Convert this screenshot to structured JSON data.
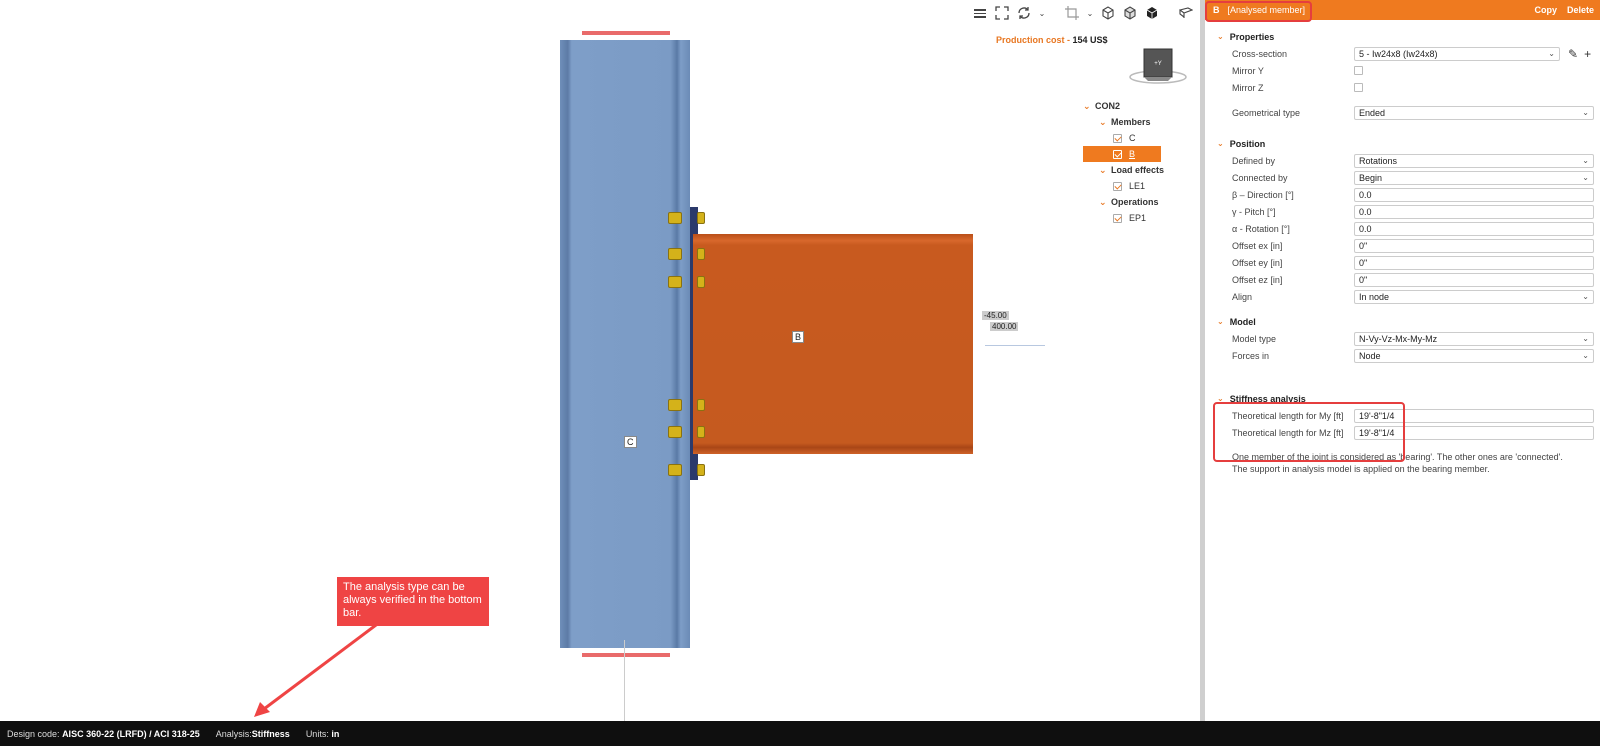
{
  "viewport": {
    "production_cost_label": "Production cost",
    "production_cost_sep": " - ",
    "production_cost_value": "154 US$",
    "cube_label": "+Y",
    "member_c_label": "C",
    "member_b_label": "B",
    "dim_1": "-45.00",
    "dim_2": "400.00",
    "callout_text": "The analysis type can be always verified in the bottom bar."
  },
  "tree": {
    "root": "CON2",
    "members_group": "Members",
    "members": [
      "C",
      "B"
    ],
    "load_effects_group": "Load effects",
    "load_effects": [
      "LE1"
    ],
    "operations_group": "Operations",
    "operations": [
      "EP1"
    ]
  },
  "statusbar": {
    "design_code_label": "Design code:",
    "design_code_value": "AISC 360-22 (LRFD) / ACI 318-25",
    "analysis_label": "Analysis:",
    "analysis_value": "Stiffness",
    "units_label": "Units:",
    "units_value": "in"
  },
  "panel": {
    "member_id": "B",
    "member_title": "[Analysed member]",
    "copy_label": "Copy",
    "delete_label": "Delete",
    "properties": {
      "title": "Properties",
      "cross_section_label": "Cross-section",
      "cross_section_value": "5 - Iw24x8 (Iw24x8)",
      "mirror_y_label": "Mirror Y",
      "mirror_z_label": "Mirror Z",
      "geometrical_type_label": "Geometrical type",
      "geometrical_type_value": "Ended"
    },
    "position": {
      "title": "Position",
      "rows": [
        {
          "label": "Defined by",
          "value": "Rotations",
          "dropdown": true
        },
        {
          "label": "Connected by",
          "value": "Begin",
          "dropdown": true
        },
        {
          "label": "β – Direction [°]",
          "value": "0.0",
          "dropdown": false
        },
        {
          "label": "γ - Pitch [°]",
          "value": "0.0",
          "dropdown": false
        },
        {
          "label": "α - Rotation [°]",
          "value": "0.0",
          "dropdown": false
        },
        {
          "label": "Offset ex [in]",
          "value": "0\"",
          "dropdown": false
        },
        {
          "label": "Offset ey [in]",
          "value": "0\"",
          "dropdown": false
        },
        {
          "label": "Offset ez [in]",
          "value": "0\"",
          "dropdown": false
        },
        {
          "label": "Align",
          "value": "In node",
          "dropdown": true
        }
      ]
    },
    "model": {
      "title": "Model",
      "model_type_label": "Model type",
      "model_type_value": "N-Vy-Vz-Mx-My-Mz",
      "forces_in_label": "Forces in",
      "forces_in_value": "Node"
    },
    "stiffness": {
      "title": "Stiffness analysis",
      "length_my_label": "Theoretical length for My [ft]",
      "length_my_value": "19'-8\"1/4",
      "length_mz_label": "Theoretical length for Mz [ft]",
      "length_mz_value": "19'-8\"1/4"
    },
    "note": "One member of the joint is considered as 'bearing'. The other ones are 'connected'. The support in analysis model is applied on the bearing member."
  },
  "colors": {
    "accent": "#ef7a1f",
    "column_blue": "#7b9cc4",
    "beam_orange": "#c8561c",
    "highlight_red": "#e53e3e",
    "callout_red": "#ef4444"
  }
}
